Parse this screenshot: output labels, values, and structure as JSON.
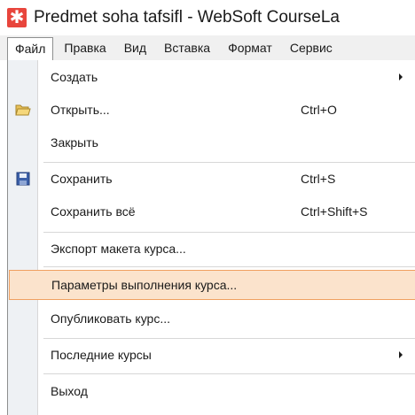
{
  "window": {
    "title": "Predmet soha tafsifl - WebSoft CourseLa",
    "app_icon_glyph": "✱"
  },
  "menubar": {
    "items": [
      {
        "label": "Файл"
      },
      {
        "label": "Правка"
      },
      {
        "label": "Вид"
      },
      {
        "label": "Вставка"
      },
      {
        "label": "Формат"
      },
      {
        "label": "Сервис"
      }
    ]
  },
  "file_menu": {
    "items": [
      {
        "label": "Создать",
        "shortcut": "",
        "submenu": true,
        "icon": ""
      },
      {
        "label": "Открыть...",
        "shortcut": "Ctrl+O",
        "submenu": false,
        "icon": "open-folder-icon"
      },
      {
        "label": "Закрыть",
        "shortcut": "",
        "submenu": false,
        "icon": ""
      },
      {
        "label": "Сохранить",
        "shortcut": "Ctrl+S",
        "submenu": false,
        "icon": "save-disk-icon"
      },
      {
        "label": "Сохранить всё",
        "shortcut": "Ctrl+Shift+S",
        "submenu": false,
        "icon": ""
      },
      {
        "label": "Экспорт макета курса...",
        "shortcut": "",
        "submenu": false,
        "icon": ""
      },
      {
        "label": "Параметры выполнения курса...",
        "shortcut": "",
        "submenu": false,
        "icon": "",
        "highlighted": true
      },
      {
        "label": "Опубликовать курс...",
        "shortcut": "",
        "submenu": false,
        "icon": ""
      },
      {
        "label": "Последние курсы",
        "shortcut": "",
        "submenu": true,
        "icon": ""
      },
      {
        "label": "Выход",
        "shortcut": "",
        "submenu": false,
        "icon": ""
      }
    ]
  },
  "colors": {
    "highlight_fill": "#fbe3cc",
    "highlight_border": "#f0a060",
    "gutter": "#eef1f4",
    "app_icon": "#e8453c"
  }
}
